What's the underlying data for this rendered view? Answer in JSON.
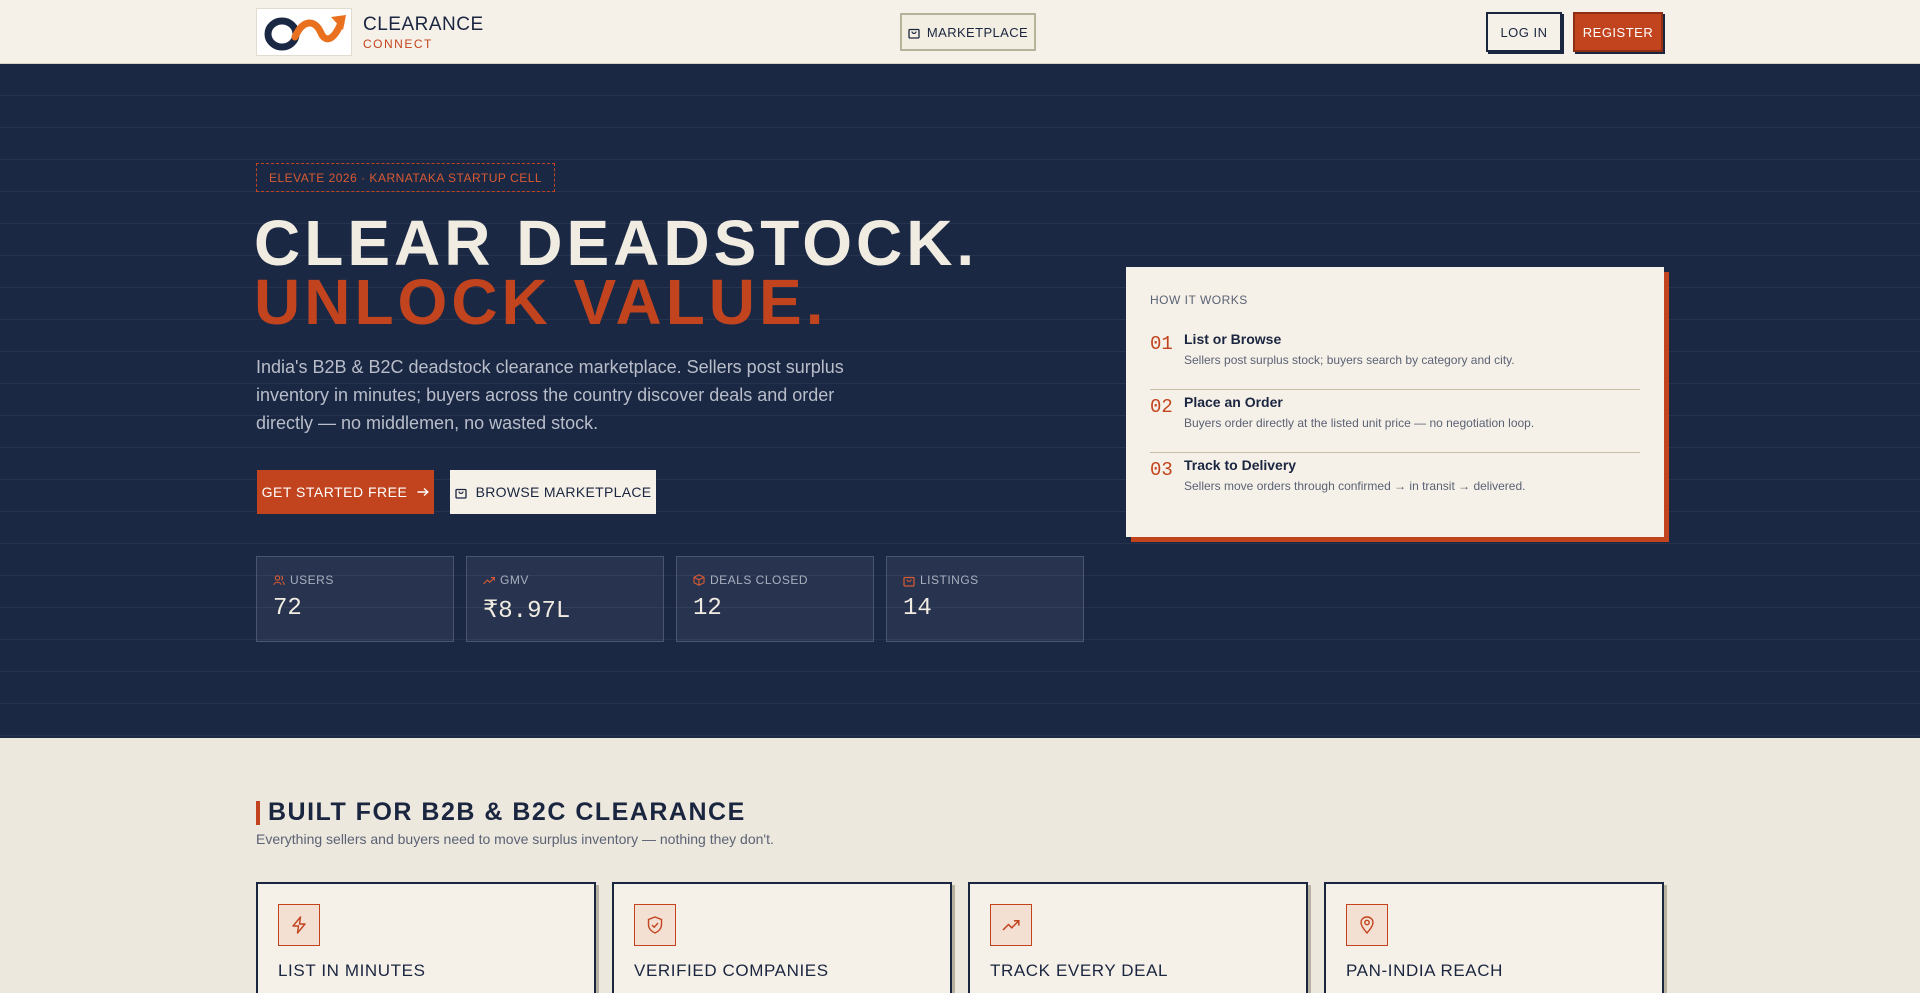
{
  "colors": {
    "navy": "#1b2844",
    "accent": "#c2441e",
    "cream": "#f6f1e8",
    "sand": "#ede8dd"
  },
  "nav": {
    "logo_icon": "infinity-arrow-logo-icon",
    "brand_title": "CLEARANCE",
    "brand_sub": "CONNECT",
    "marketplace_icon": "shopping-bag-icon",
    "marketplace_label": "MARKETPLACE",
    "login_label": "LOG IN",
    "register_label": "REGISTER"
  },
  "hero": {
    "tag": "ELEVATE 2026 · KARNATAKA STARTUP CELL",
    "headline_line1": "CLEAR DEADSTOCK.",
    "headline_line2": "UNLOCK VALUE.",
    "lede": "India's B2B & B2C deadstock clearance marketplace. Sellers post surplus inventory in minutes; buyers across the country discover deals and order directly — no middlemen, no wasted stock.",
    "cta_primary": "GET STARTED FREE",
    "cta_primary_icon": "arrow-right-icon",
    "cta_secondary": "BROWSE MARKETPLACE",
    "cta_secondary_icon": "shopping-bag-icon"
  },
  "stats": [
    {
      "icon": "users-icon",
      "label": "USERS",
      "value": "72"
    },
    {
      "icon": "trending-up-icon",
      "label": "GMV",
      "value": "₹8.97L"
    },
    {
      "icon": "package-icon",
      "label": "DEALS CLOSED",
      "value": "12"
    },
    {
      "icon": "shopping-bag-icon",
      "label": "LISTINGS",
      "value": "14"
    }
  ],
  "how_it_works": {
    "title": "HOW IT WORKS",
    "steps": [
      {
        "num": "01",
        "title": "List or Browse",
        "desc": "Sellers post surplus stock; buyers search by category and city."
      },
      {
        "num": "02",
        "title": "Place an Order",
        "desc": "Buyers order directly at the listed unit price — no negotiation loop."
      },
      {
        "num": "03",
        "title": "Track to Delivery",
        "desc": "Sellers move orders through confirmed → in transit → delivered."
      }
    ]
  },
  "features_section": {
    "title": "BUILT FOR B2B & B2C CLEARANCE",
    "subtitle": "Everything sellers and buyers need to move surplus inventory — nothing they don't.",
    "cards": [
      {
        "icon": "lightning-icon",
        "title": "LIST IN MINUTES"
      },
      {
        "icon": "shield-check-icon",
        "title": "VERIFIED COMPANIES"
      },
      {
        "icon": "trending-up-icon",
        "title": "TRACK EVERY DEAL"
      },
      {
        "icon": "map-pin-icon",
        "title": "PAN-INDIA REACH"
      }
    ]
  }
}
